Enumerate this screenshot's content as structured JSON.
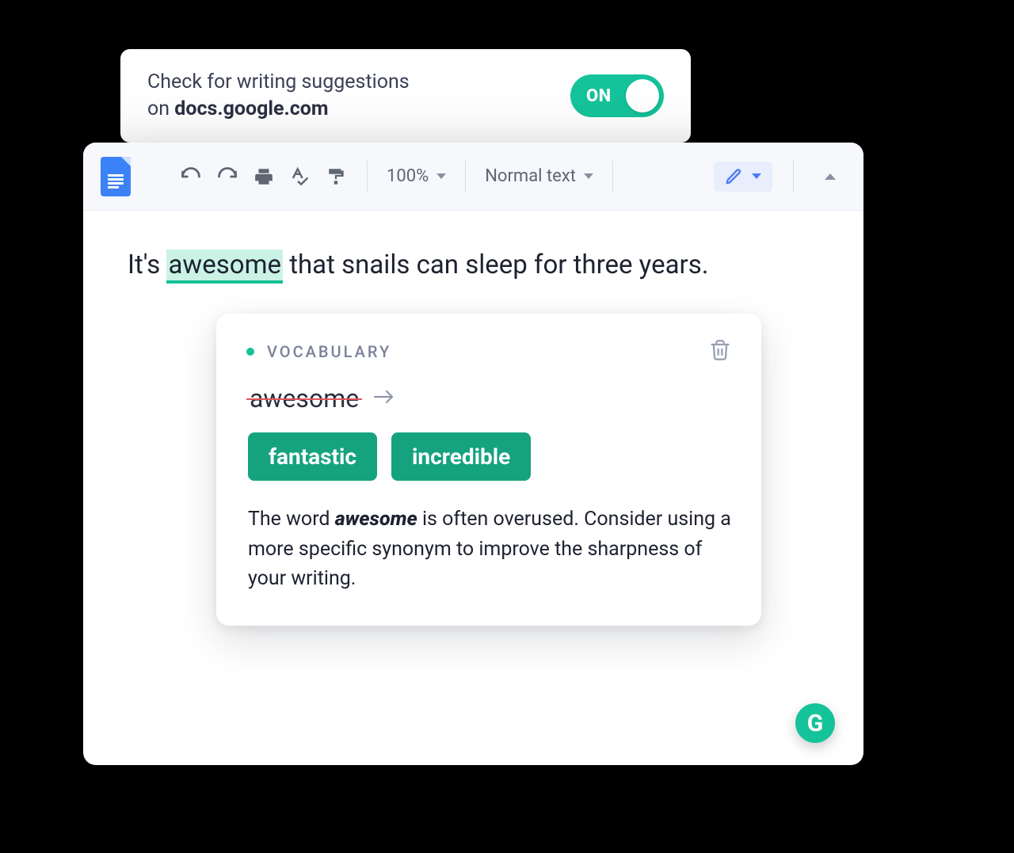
{
  "settings": {
    "line1": "Check for writing suggestions",
    "line2_prefix": "on ",
    "domain": "docs.google.com",
    "toggle_label": "ON"
  },
  "toolbar": {
    "zoom": "100%",
    "style": "Normal text"
  },
  "document": {
    "prefix": "It's ",
    "highlighted": "awesome",
    "suffix": " that snails can sleep for three years."
  },
  "suggestion": {
    "category": "VOCABULARY",
    "original_word": "awesome",
    "replacements": [
      "fantastic",
      "incredible"
    ],
    "desc_pre": "The word ",
    "desc_bold": "awesome",
    "desc_post": " is often overused. Consider using a more specific synonym to improve the sharpness of your writing."
  },
  "fab": {
    "glyph": "G"
  },
  "colors": {
    "accent": "#15c39a",
    "chip": "#15a37f",
    "editor_bg": "#f6f8fc",
    "docs_blue": "#3b82f6"
  }
}
